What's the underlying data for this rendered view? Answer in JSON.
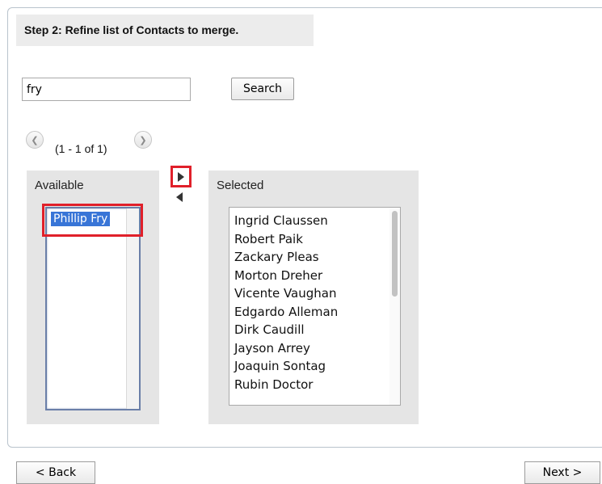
{
  "step_title": "Step 2: Refine list of Contacts to merge.",
  "search": {
    "value": "fry",
    "button_label": "Search"
  },
  "pager": {
    "text": "(1 - 1 of 1)",
    "prev_icon": "chevron-left-icon",
    "next_icon": "chevron-right-icon"
  },
  "available": {
    "label": "Available",
    "items": [
      "Phillip Fry"
    ]
  },
  "selected": {
    "label": "Selected",
    "items": [
      "Ingrid Claussen",
      "Robert Paik",
      "Zackary Pleas",
      "Morton Dreher",
      "Vicente Vaughan",
      "Edgardo Alleman",
      "Dirk Caudill",
      "Jayson Arrey",
      "Joaquin Sontag",
      "Rubin Doctor"
    ]
  },
  "nav": {
    "back_label": "< Back",
    "next_label": "Next >"
  },
  "colors": {
    "highlight": "#e0202a",
    "selection": "#3875d7",
    "box_bg": "#e5e5e5"
  }
}
